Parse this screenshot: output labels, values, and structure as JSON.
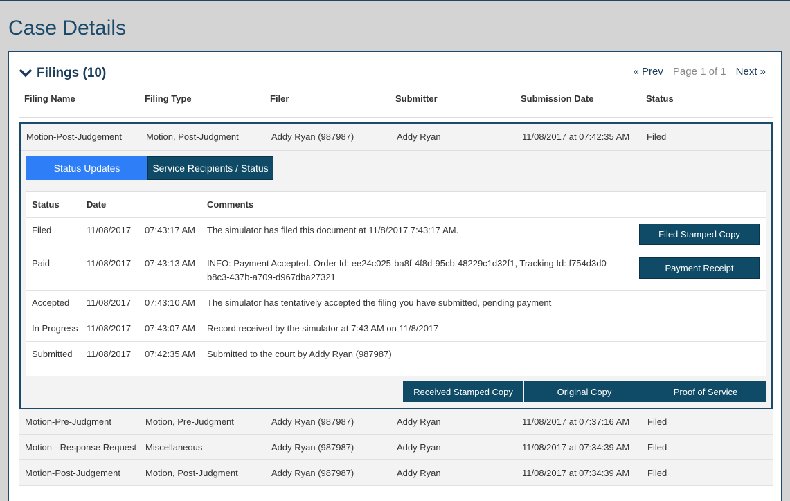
{
  "page": {
    "title": "Case Details"
  },
  "section": {
    "title": "Filings (10)",
    "toggle_icon": "chevron-down-icon"
  },
  "pager": {
    "prev": "« Prev",
    "info": "Page 1 of 1",
    "next": "Next »"
  },
  "columns": [
    "Filing Name",
    "Filing Type",
    "Filer",
    "Submitter",
    "Submission Date",
    "Status"
  ],
  "expanded_filing": {
    "name": "Motion-Post-Judgement",
    "type": "Motion, Post-Judgment",
    "filer": "Addy Ryan (987987)",
    "submitter": "Addy Ryan",
    "date": "11/08/2017 at 07:42:35 AM",
    "status": "Filed",
    "tabs": {
      "active": "Status Updates",
      "inactive": "Service Recipients / Status"
    },
    "status_columns": [
      "Status",
      "Date",
      "Comments"
    ],
    "status_rows": [
      {
        "status": "Filed",
        "date": "11/08/2017",
        "time": "07:43:17 AM",
        "comment": "The simulator has filed this document at 11/8/2017 7:43:17 AM.",
        "button": "Filed Stamped Copy"
      },
      {
        "status": "Paid",
        "date": "11/08/2017",
        "time": "07:43:13 AM",
        "comment": "INFO: Payment Accepted. Order Id: ee24c025-ba8f-4f8d-95cb-48229c1d32f1, Tracking Id: f754d3d0-b8c3-437b-a709-d967dba27321",
        "button": "Payment Receipt"
      },
      {
        "status": "Accepted",
        "date": "11/08/2017",
        "time": "07:43:10 AM",
        "comment": "The simulator has tentatively accepted the filing you have submitted, pending payment"
      },
      {
        "status": "In Progress",
        "date": "11/08/2017",
        "time": "07:43:07 AM",
        "comment": "Record received by the simulator at 7:43 AM on 11/8/2017"
      },
      {
        "status": "Submitted",
        "date": "11/08/2017",
        "time": "07:42:35 AM",
        "comment": "Submitted to the court by Addy Ryan (987987)"
      }
    ],
    "bottom_buttons": [
      "Received Stamped Copy",
      "Original Copy",
      "Proof of Service"
    ]
  },
  "filings": [
    {
      "name": "Motion-Pre-Judgment",
      "type": "Motion, Pre-Judgment",
      "filer": "Addy Ryan (987987)",
      "submitter": "Addy Ryan",
      "date": "11/08/2017 at 07:37:16 AM",
      "status": "Filed"
    },
    {
      "name": "Motion - Response Request",
      "type": "Miscellaneous",
      "filer": "Addy Ryan (987987)",
      "submitter": "Addy Ryan",
      "date": "11/08/2017 at 07:34:39 AM",
      "status": "Filed"
    },
    {
      "name": "Motion-Post-Judgement",
      "type": "Motion, Post-Judgment",
      "filer": "Addy Ryan (987987)",
      "submitter": "Addy Ryan",
      "date": "11/08/2017 at 07:34:39 AM",
      "status": "Filed"
    }
  ]
}
